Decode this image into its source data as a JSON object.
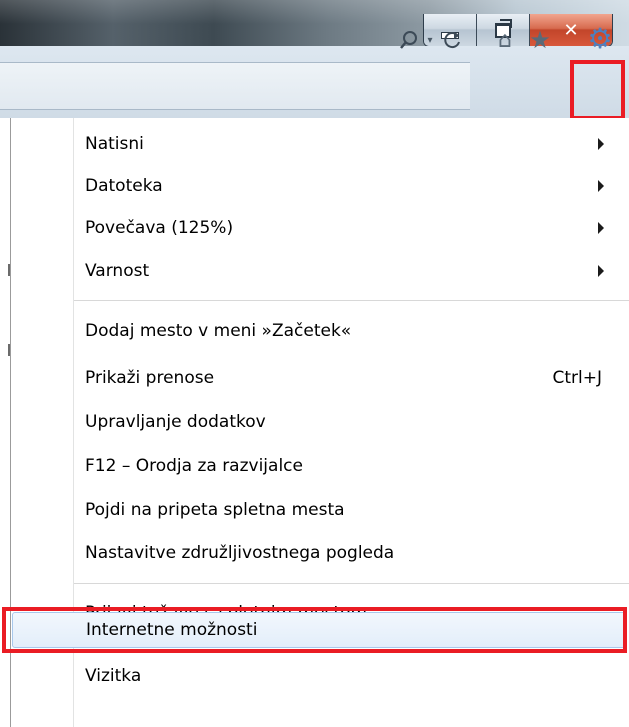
{
  "window": {
    "caption_buttons": [
      {
        "icon": "minimize-icon"
      },
      {
        "icon": "maximize-icon"
      },
      {
        "icon": "close-icon"
      }
    ]
  },
  "toolbar": {
    "icons": [
      "search-icon",
      "chevron-down-icon",
      "refresh-icon",
      "home-icon",
      "star-icon",
      "gear-icon"
    ],
    "highlight_color": "#ea1c24"
  },
  "menu": {
    "groups": [
      [
        {
          "label": "Natisni",
          "submenu": true
        },
        {
          "label": "Datoteka",
          "submenu": true
        },
        {
          "label": "Povečava (125%)",
          "submenu": true
        },
        {
          "label": "Varnost",
          "submenu": true
        }
      ],
      [
        {
          "label": "Dodaj mesto v meni »Začetek«"
        },
        {
          "label": "Prikaži prenose",
          "shortcut": "Ctrl+J"
        },
        {
          "label": "Upravljanje dodatkov"
        },
        {
          "label": "F12 – Orodja za razvijalce"
        },
        {
          "label": "Pojdi na pripeta spletna mesta"
        },
        {
          "label": "Nastavitve združljivostnega pogleda"
        }
      ],
      [
        {
          "label": "Prijavi težave s spletnim mestom"
        },
        {
          "label": "Internetne možnosti",
          "hovered": true,
          "highlighted": true
        },
        {
          "label": "Vizitka"
        }
      ]
    ]
  }
}
